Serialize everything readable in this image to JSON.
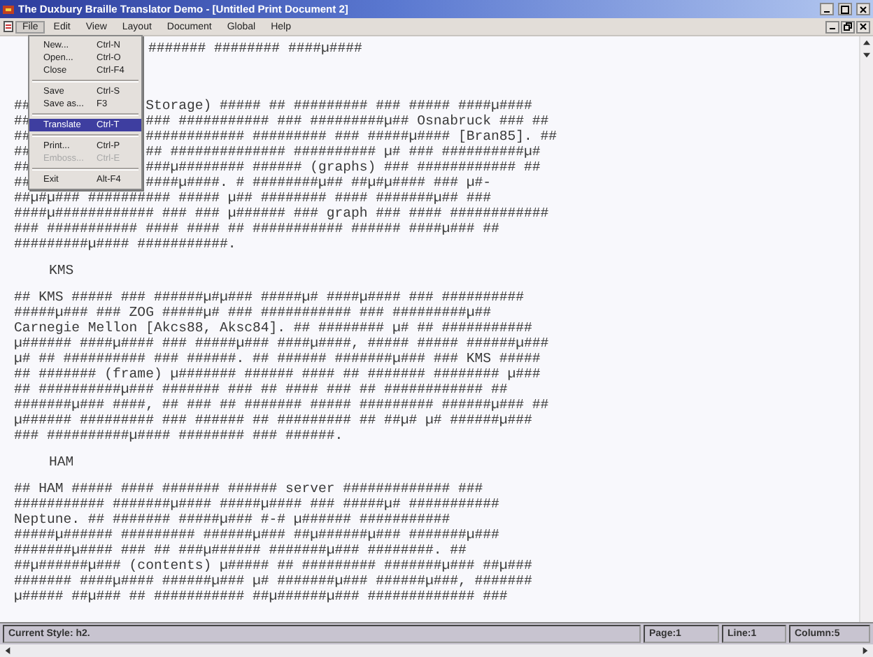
{
  "window": {
    "title": "The Duxbury Braille Translator Demo - [Untitled Print Document 2]"
  },
  "menu_bar": [
    {
      "label": "File",
      "selected": true
    },
    {
      "label": "Edit",
      "selected": false
    },
    {
      "label": "View",
      "selected": false
    },
    {
      "label": "Layout",
      "selected": false
    },
    {
      "label": "Document",
      "selected": false
    },
    {
      "label": "Global",
      "selected": false
    },
    {
      "label": "Help",
      "selected": false
    }
  ],
  "file_menu": [
    {
      "kind": "item",
      "label": "New...",
      "shortcut": "Ctrl-N",
      "selected": false,
      "disabled": false
    },
    {
      "kind": "item",
      "label": "Open...",
      "shortcut": "Ctrl-O",
      "selected": false,
      "disabled": false
    },
    {
      "kind": "item",
      "label": "Close",
      "shortcut": "Ctrl-F4",
      "selected": false,
      "disabled": false
    },
    {
      "kind": "separator"
    },
    {
      "kind": "item",
      "label": "Save",
      "shortcut": "Ctrl-S",
      "selected": false,
      "disabled": false
    },
    {
      "kind": "item",
      "label": "Save as...",
      "shortcut": "F3",
      "selected": false,
      "disabled": false
    },
    {
      "kind": "separator"
    },
    {
      "kind": "item",
      "label": "Translate",
      "shortcut": "Ctrl-T",
      "selected": true,
      "disabled": false
    },
    {
      "kind": "separator"
    },
    {
      "kind": "item",
      "label": "Print...",
      "shortcut": "Ctrl-P",
      "selected": false,
      "disabled": false
    },
    {
      "kind": "item",
      "label": "Emboss...",
      "shortcut": "Ctrl-E",
      "selected": false,
      "disabled": true
    },
    {
      "kind": "separator"
    },
    {
      "kind": "item",
      "label": "Exit",
      "shortcut": "Alt-F4",
      "selected": false,
      "disabled": false
    }
  ],
  "document": [
    {
      "kind": "top_line",
      "text": "####### ######## ####µ####"
    },
    {
      "kind": "paragraph",
      "lines": [
        {
          "left": "##",
          "right": "Storage) ##### ## ######### ### ##### ####µ####"
        },
        {
          "left": "##",
          "right": "### ########### ### #########µ## Osnabruck ### ##"
        },
        {
          "left": "##",
          "right": "############ ######### ### #####µ#### [Bran85]. ##"
        },
        {
          "left": "##",
          "right": "## ############## ########## µ# ### ##########µ#"
        },
        {
          "left": "##",
          "right": "###µ######## ###### (graphs) ### ############ ##"
        },
        {
          "left": "##",
          "right": "####µ####. # ########µ## ##µ#µ#### ### µ#-"
        },
        {
          "text": "##µ#µ### ########## ##### µ## ######## #### #######µ## ###"
        },
        {
          "text": "####µ############ ### ### µ###### ### graph ### #### ############"
        },
        {
          "text": "### ########### #### #### ## ########### ###### ####µ### ##"
        },
        {
          "text": "#########µ#### ###########."
        }
      ]
    },
    {
      "kind": "heading",
      "text": "KMS"
    },
    {
      "kind": "paragraph",
      "lines": [
        {
          "text": "## KMS ##### ### ######µ#µ### #####µ# ####µ#### ### ##########"
        },
        {
          "text": "#####µ### ### ZOG #####µ# ### ########### ### #########µ##"
        },
        {
          "text": "Carnegie Mellon [Akcs88, Aksc84]. ## ######## µ# ## ###########"
        },
        {
          "text": "µ###### ####µ#### ### #####µ### ####µ####, ##### ##### ######µ###"
        },
        {
          "text": "µ# ## ########## ### ######. ## ###### #######µ### ### KMS #####"
        },
        {
          "text": "## ####### (frame) µ####### ###### #### ## ####### ######## µ###"
        },
        {
          "text": "## ##########µ### ####### ### ## #### ### ## ############ ##"
        },
        {
          "text": "#######µ### ####, ## ### ## ####### ##### ######### ######µ### ##"
        },
        {
          "text": "µ###### ######### ### ###### ## ######### ## ##µ# µ# ######µ###"
        },
        {
          "text": "### ##########µ#### ######## ### ######."
        }
      ]
    },
    {
      "kind": "heading",
      "text": "HAM"
    },
    {
      "kind": "paragraph",
      "lines": [
        {
          "text": "## HAM ##### #### ####### ###### server ############# ###"
        },
        {
          "text": "########### #######µ#### #####µ#### ### #####µ# ###########"
        },
        {
          "text": "Neptune. ## ####### #####µ### #-# µ###### ###########"
        },
        {
          "text": "#####µ###### ######### ######µ### ##µ######µ### #######µ###"
        },
        {
          "text": "#######µ#### ### ## ###µ###### #######µ### ########. ##"
        },
        {
          "text": "##µ######µ### (contents) µ##### ## ######### #######µ### ##µ###"
        },
        {
          "text": "####### ####µ#### ######µ### µ# #######µ### ######µ###, #######"
        },
        {
          "text": "µ##### ##µ### ## ########### ##µ######µ### ############# ###"
        }
      ]
    }
  ],
  "status_bar": {
    "style": "Current Style: h2.",
    "page": "Page:1",
    "line": "Line:1",
    "column": "Column:5"
  }
}
